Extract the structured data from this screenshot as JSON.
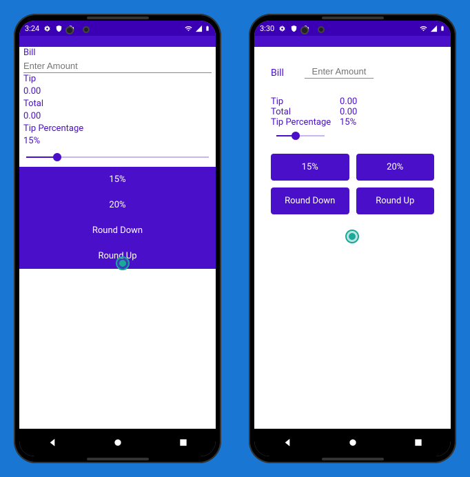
{
  "phoneA": {
    "status": {
      "time": "3:24"
    },
    "bill_label": "Bill",
    "amount_placeholder": "Enter Amount",
    "tip_label": "Tip",
    "tip_value": "0.00",
    "total_label": "Total",
    "total_value": "0.00",
    "tip_pct_label": "Tip Percentage",
    "tip_pct_value": "15%",
    "slider_pct": 17,
    "buttons": {
      "b15": "15%",
      "b20": "20%",
      "round_down": "Round Down",
      "round_up": "Round Up"
    }
  },
  "phoneB": {
    "status": {
      "time": "3:30"
    },
    "bill_label": "Bill",
    "amount_placeholder": "Enter Amount",
    "tip_label": "Tip",
    "tip_value": "0.00",
    "total_label": "Total",
    "total_value": "0.00",
    "tip_pct_label": "Tip Percentage",
    "tip_pct_value": "15%",
    "slider_pct": 40,
    "buttons": {
      "b15": "15%",
      "b20": "20%",
      "round_down": "Round Down",
      "round_up": "Round Up"
    }
  }
}
